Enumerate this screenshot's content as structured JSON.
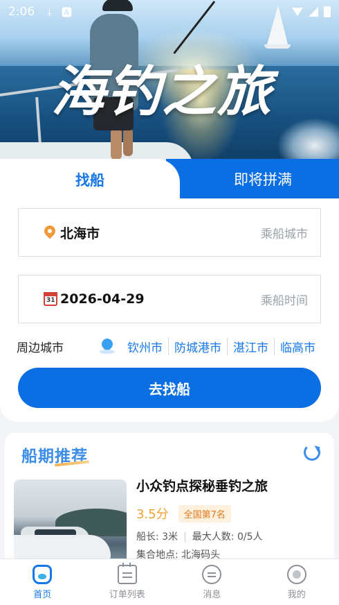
{
  "status_bar": {
    "time": "2:06",
    "icons": [
      "download-icon",
      "notification-a-icon",
      "wifi-icon",
      "signal-icon",
      "battery-icon"
    ]
  },
  "hero": {
    "title": "海钓之旅"
  },
  "tabs": {
    "find_boat": "找船",
    "almost_full": "即将拼满"
  },
  "search": {
    "city_value": "北海市",
    "city_hint": "乘船城市",
    "date_value": "2026-04-29",
    "date_hint": "乘船时间",
    "calendar_day": "31",
    "nearby_label": "周边城市",
    "nearby_cities": [
      "钦州市",
      "防城港市",
      "湛江市",
      "临高市"
    ],
    "go_button": "去找船"
  },
  "recommend": {
    "section_title": "船期推荐",
    "trip": {
      "name": "小众钓点探秘垂钓之旅",
      "score": "3.5分",
      "rank": "全国第7名",
      "captain": "船长: 3米",
      "capacity": "最大人数: 0/5人",
      "meeting_place": "集合地点: 北海码头"
    }
  },
  "bottom_nav": {
    "home": "首页",
    "orders": "订单列表",
    "messages": "消息",
    "mine": "我的"
  },
  "colors": {
    "primary": "#0b6fe3",
    "accent_blue": "#1677e8",
    "score_orange": "#f0a22c"
  }
}
